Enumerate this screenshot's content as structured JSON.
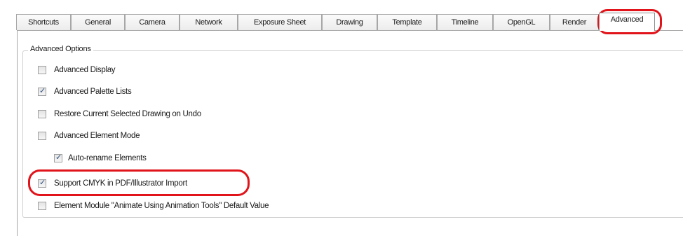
{
  "tabs": [
    {
      "label": "Shortcuts",
      "active": false
    },
    {
      "label": "General",
      "active": false
    },
    {
      "label": "Camera",
      "active": false
    },
    {
      "label": "Network",
      "active": false
    },
    {
      "label": "Exposure Sheet",
      "active": false
    },
    {
      "label": "Drawing",
      "active": false
    },
    {
      "label": "Template",
      "active": false
    },
    {
      "label": "Timeline",
      "active": false
    },
    {
      "label": "OpenGL",
      "active": false
    },
    {
      "label": "Render",
      "active": false
    },
    {
      "label": "Advanced",
      "active": true
    }
  ],
  "group": {
    "title": "Advanced Options",
    "options": [
      {
        "label": "Advanced Display",
        "checked": false
      },
      {
        "label": "Advanced Palette Lists",
        "checked": true
      },
      {
        "label": "Restore Current Selected Drawing on Undo",
        "checked": false
      },
      {
        "label": "Advanced Element Mode",
        "checked": false
      },
      {
        "label": "Auto-rename Elements",
        "checked": true
      },
      {
        "label": "Support CMYK in PDF/Illustrator Import",
        "checked": true
      },
      {
        "label": "Element Module \"Animate Using Animation Tools\" Default Value",
        "checked": false
      }
    ]
  },
  "colors": {
    "highlight": "#e0141a",
    "check": "#2a4c7d"
  }
}
